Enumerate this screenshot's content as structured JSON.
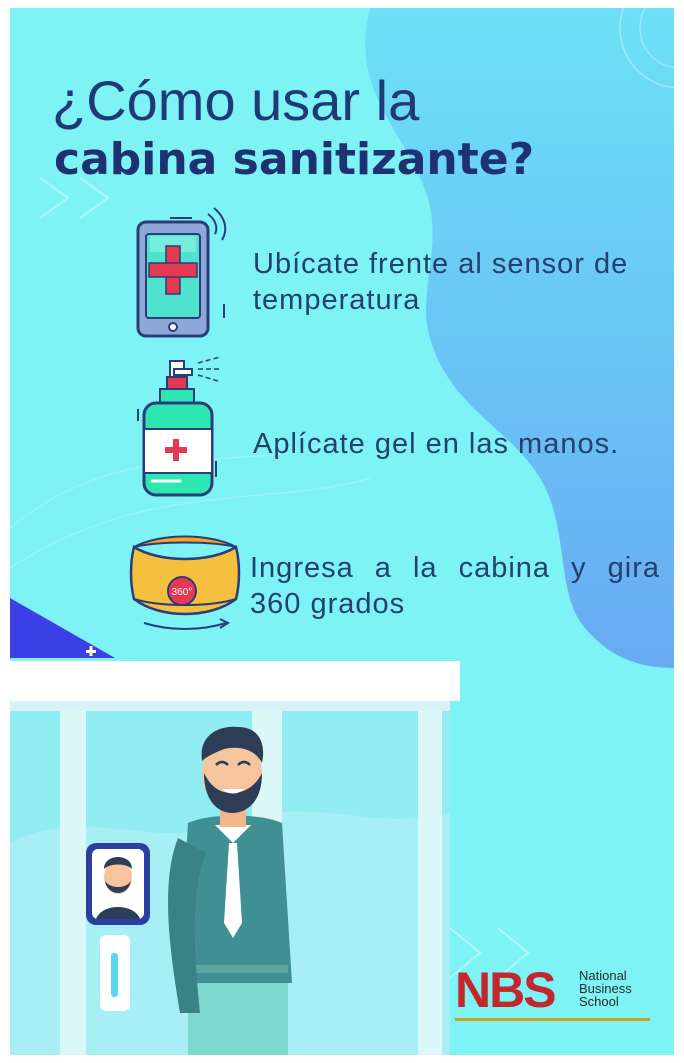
{
  "title": {
    "line1": "¿Cómo usar la",
    "line2": "cabina sanitizante?"
  },
  "steps": [
    {
      "icon": "phone-thermometer-icon",
      "text": "Ubícate frente al sensor de temperatura"
    },
    {
      "icon": "sanitizer-bottle-icon",
      "text": "Aplícate gel en las manos."
    },
    {
      "icon": "rotation-360-icon",
      "text": "Ingresa a la cabina y gira 360 grados",
      "badge": "360°"
    }
  ],
  "logo": {
    "mark": "NBS",
    "line1": "National",
    "line2": "Business",
    "line3": "School"
  },
  "colors": {
    "background": "#7df3f5",
    "title": "#1f3170",
    "accent_red": "#e53950",
    "accent_green": "#2ee6b2",
    "blob": "#6aaef3",
    "logo_red": "#c1272d"
  }
}
